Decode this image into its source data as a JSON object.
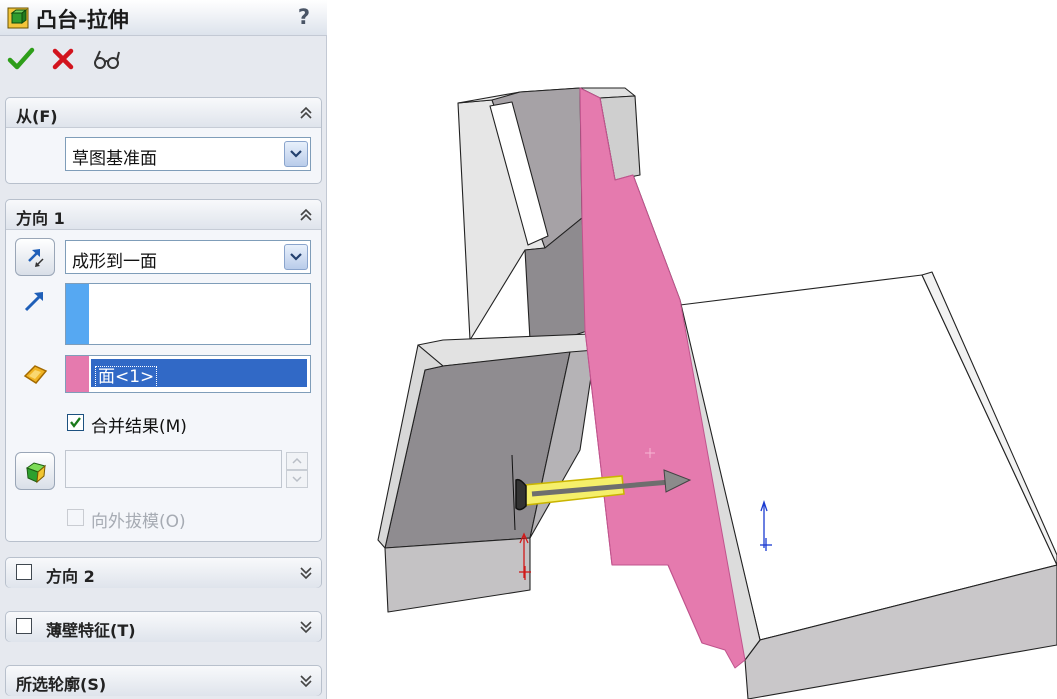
{
  "title": "凸台-拉伸",
  "help": "?",
  "actions": {
    "ok_icon": "check-icon",
    "cancel_icon": "x-icon",
    "preview_icon": "glasses-icon"
  },
  "from_group": {
    "title": "从(F)",
    "value": "草图基准面"
  },
  "direction1_group": {
    "title": "方向 1",
    "end_condition": "成形到一面",
    "face_selection": "面<1>",
    "merge_result": "合并结果(M)",
    "draft_outward": "向外拔模(O)"
  },
  "direction2_group": {
    "title": "方向 2"
  },
  "thin_feature_group": {
    "title": "薄壁特征(T)"
  },
  "selected_contours_group": {
    "title": "所选轮廓(S)"
  },
  "colors": {
    "panel_bg": "#e6e9ef",
    "selection_highlight": "#3169c6",
    "face_pink": "#e57aae",
    "direction_blue": "#56a8f2",
    "ok_green": "#2e9e1a",
    "cancel_red": "#d2141e"
  }
}
